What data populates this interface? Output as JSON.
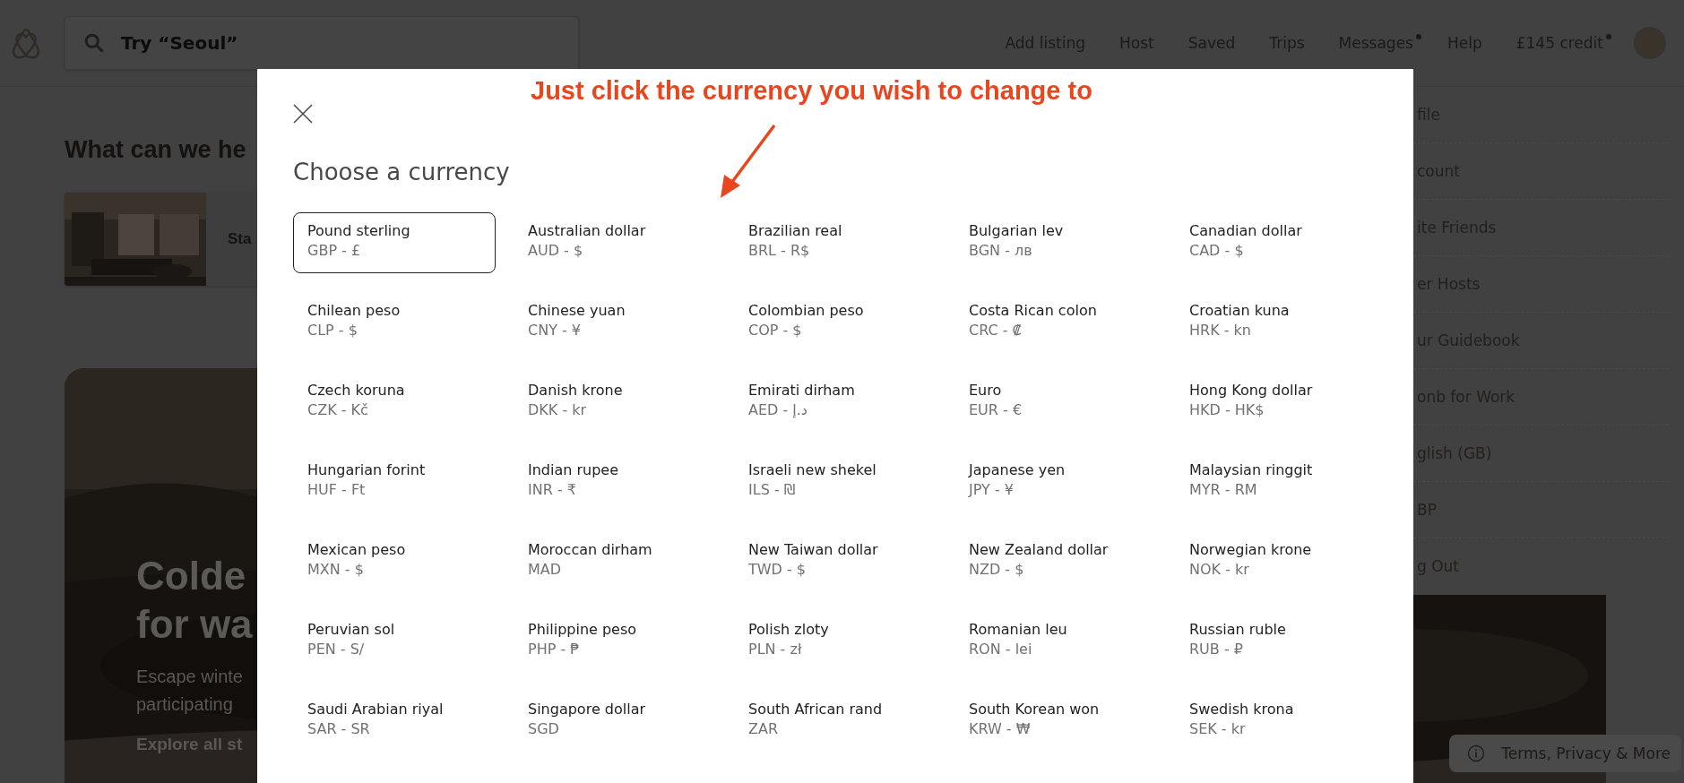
{
  "header": {
    "search": {
      "placeholder": "Try “Seoul”"
    },
    "nav": [
      {
        "label": "Add listing",
        "dot": false
      },
      {
        "label": "Host",
        "dot": false
      },
      {
        "label": "Saved",
        "dot": false
      },
      {
        "label": "Trips",
        "dot": false
      },
      {
        "label": "Messages",
        "dot": true
      },
      {
        "label": "Help",
        "dot": false
      },
      {
        "label": "£145 credit",
        "dot": true
      }
    ]
  },
  "page": {
    "heading": "What can we he",
    "card_text": "Sta",
    "hero": {
      "title_lines": [
        "Colde",
        "for wa"
      ],
      "body_lines": [
        "Escape winte",
        "participating"
      ],
      "link": "Explore all st"
    }
  },
  "account_menu": {
    "items": [
      "file",
      "count",
      "ite Friends",
      "er Hosts",
      "ur Guidebook",
      "onb for Work",
      "glish (GB)",
      "BP",
      "g Out"
    ]
  },
  "footer_button": "Terms, Privacy & More",
  "modal": {
    "annotation": "Just click the currency you wish to change to",
    "title": "Choose a currency",
    "currencies": [
      {
        "name": "Pound sterling",
        "code": "GBP - £",
        "selected": true
      },
      {
        "name": "Australian dollar",
        "code": "AUD - $",
        "selected": false
      },
      {
        "name": "Brazilian real",
        "code": "BRL - R$",
        "selected": false
      },
      {
        "name": "Bulgarian lev",
        "code": "BGN - лв",
        "selected": false
      },
      {
        "name": "Canadian dollar",
        "code": "CAD - $",
        "selected": false
      },
      {
        "name": "Chilean peso",
        "code": "CLP - $",
        "selected": false
      },
      {
        "name": "Chinese yuan",
        "code": "CNY - ¥",
        "selected": false
      },
      {
        "name": "Colombian peso",
        "code": "COP - $",
        "selected": false
      },
      {
        "name": "Costa Rican colon",
        "code": "CRC - ₡",
        "selected": false
      },
      {
        "name": "Croatian kuna",
        "code": "HRK - kn",
        "selected": false
      },
      {
        "name": "Czech koruna",
        "code": "CZK - Kč",
        "selected": false
      },
      {
        "name": "Danish krone",
        "code": "DKK - kr",
        "selected": false
      },
      {
        "name": "Emirati dirham",
        "code": "AED - د.إ",
        "selected": false
      },
      {
        "name": "Euro",
        "code": "EUR - €",
        "selected": false
      },
      {
        "name": "Hong Kong dollar",
        "code": "HKD - HK$",
        "selected": false
      },
      {
        "name": "Hungarian forint",
        "code": "HUF - Ft",
        "selected": false
      },
      {
        "name": "Indian rupee",
        "code": "INR - ₹",
        "selected": false
      },
      {
        "name": "Israeli new shekel",
        "code": "ILS - ₪",
        "selected": false
      },
      {
        "name": "Japanese yen",
        "code": "JPY - ¥",
        "selected": false
      },
      {
        "name": "Malaysian ringgit",
        "code": "MYR - RM",
        "selected": false
      },
      {
        "name": "Mexican peso",
        "code": "MXN - $",
        "selected": false
      },
      {
        "name": "Moroccan dirham",
        "code": "MAD",
        "selected": false
      },
      {
        "name": "New Taiwan dollar",
        "code": "TWD - $",
        "selected": false
      },
      {
        "name": "New Zealand dollar",
        "code": "NZD - $",
        "selected": false
      },
      {
        "name": "Norwegian krone",
        "code": "NOK - kr",
        "selected": false
      },
      {
        "name": "Peruvian sol",
        "code": "PEN - S/",
        "selected": false
      },
      {
        "name": "Philippine peso",
        "code": "PHP - ₱",
        "selected": false
      },
      {
        "name": "Polish zloty",
        "code": "PLN - zł",
        "selected": false
      },
      {
        "name": "Romanian leu",
        "code": "RON - lei",
        "selected": false
      },
      {
        "name": "Russian ruble",
        "code": "RUB - ₽",
        "selected": false
      },
      {
        "name": "Saudi Arabian riyal",
        "code": "SAR - SR",
        "selected": false
      },
      {
        "name": "Singapore dollar",
        "code": "SGD",
        "selected": false
      },
      {
        "name": "South African rand",
        "code": "ZAR",
        "selected": false
      },
      {
        "name": "South Korean won",
        "code": "KRW - ₩",
        "selected": false
      },
      {
        "name": "Swedish krona",
        "code": "SEK - kr",
        "selected": false
      }
    ]
  }
}
